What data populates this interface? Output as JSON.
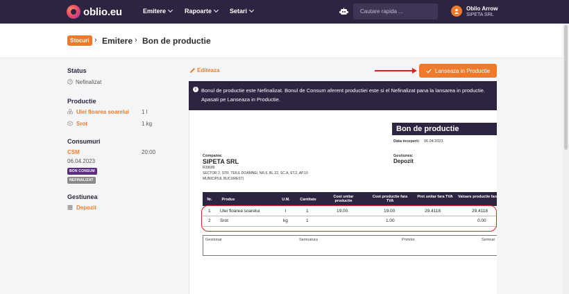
{
  "nav": {
    "logo": "oblio.eu",
    "menu": [
      {
        "label": "Emitere"
      },
      {
        "label": "Rapoarte"
      },
      {
        "label": "Setari"
      }
    ],
    "search_placeholder": "Cautare rapida ...",
    "user_name": "Oblio Arrow",
    "user_company": "SIPETA SRL"
  },
  "breadcrumb": {
    "badge": "Stocuri",
    "level1": "Emitere",
    "level2": "Bon de productie"
  },
  "sidebar": {
    "status_title": "Status",
    "status_value": "Nefinalizat",
    "productie_title": "Productie",
    "productie_items": [
      {
        "name": "Ulei floarea soarelui",
        "qty": "1 l"
      },
      {
        "name": "Srot",
        "qty": "1 kg"
      }
    ],
    "consumuri_title": "Consumuri",
    "consum_name": "CSM",
    "consum_time": "20:00",
    "consum_date": "06.04.2023",
    "badge_bon": "BON CONSUM",
    "badge_nefin": "NEFINALIZAT",
    "gestiunea_title": "Gestiunea",
    "gestiunea_value": "Depozit"
  },
  "actions": {
    "edit_label": "Editeaza",
    "launch_label": "Lanseaza in Productie"
  },
  "info_text": "Bonul de productie este Nefinalizat. Bonul de Consum aferent productiei este si el Nefinalizat pana la lansarea in productie. Apasati pe Lanseaza in Productie.",
  "document": {
    "title": "Bon de productie",
    "date_label": "Data inceperii:",
    "date_value": "06.04.2023",
    "company_label": "Compania:",
    "company_name": "SIPETA SRL",
    "company_code": "R39689",
    "company_address": "SECTOR 2, STR. TEIUL DOAMNEI, NR.6, BL.22, SC.A, ET.2, AP.10",
    "company_city": "MUNICIPIUL BUCURESTI",
    "gestiunea_label": "Gestiunea:",
    "gestiunea_value": "Depozit",
    "columns": [
      "Nr.",
      "Produs",
      "U.M.",
      "Cantitate",
      "Cost unitar productie",
      "Cost productie fara TVA",
      "Pret unitar fara TVA",
      "Valoare productie fara TVA"
    ],
    "rows": [
      {
        "nr": "1",
        "produs": "Ulei floarea soarelui",
        "um": "l",
        "cant": "1",
        "cost_unit": "19.00",
        "cost_total": "19.00",
        "pret_unit": "29.4118",
        "valoare": "29.4118"
      },
      {
        "nr": "2",
        "produs": "Srot",
        "um": "kg",
        "cant": "1",
        "cost_unit": "",
        "cost_total": "1.00",
        "pret_unit": "",
        "valoare": "0.00"
      }
    ],
    "sign": [
      "Gestionar",
      "Semnatura",
      "Primitor",
      "Semnat"
    ]
  },
  "colors": {
    "brand_dark": "#2d2442",
    "accent": "#f07a2b",
    "annotation": "#e02020"
  }
}
